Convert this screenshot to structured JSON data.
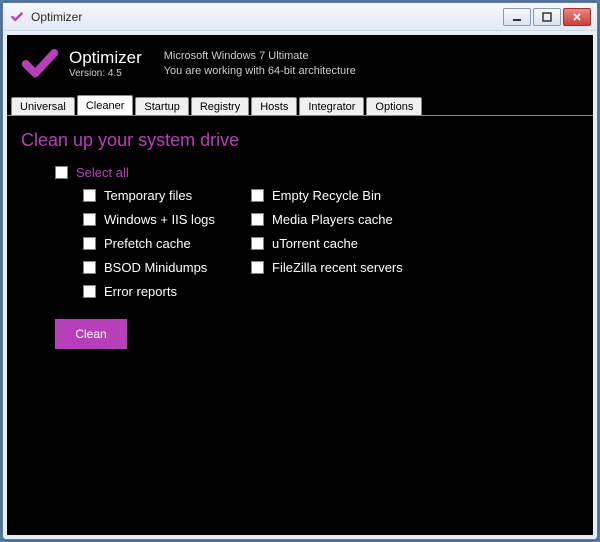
{
  "window": {
    "title": "Optimizer"
  },
  "header": {
    "app_name": "Optimizer",
    "version_label": "Version: 4.5",
    "os_line1": "Microsoft Windows 7 Ultimate",
    "os_line2": "You are working with 64-bit architecture"
  },
  "tabs": [
    {
      "label": "Universal"
    },
    {
      "label": "Cleaner"
    },
    {
      "label": "Startup"
    },
    {
      "label": "Registry"
    },
    {
      "label": "Hosts"
    },
    {
      "label": "Integrator"
    },
    {
      "label": "Options"
    }
  ],
  "active_tab_index": 1,
  "cleaner": {
    "heading": "Clean up your system drive",
    "select_all_label": "Select all",
    "col1": [
      "Temporary files",
      "Windows + IIS logs",
      "Prefetch cache",
      "BSOD Minidumps",
      "Error reports"
    ],
    "col2": [
      "Empty Recycle Bin",
      "Media Players cache",
      "uTorrent cache",
      "FileZilla recent servers"
    ],
    "clean_button": "Clean"
  },
  "colors": {
    "accent": "#b83fba"
  }
}
